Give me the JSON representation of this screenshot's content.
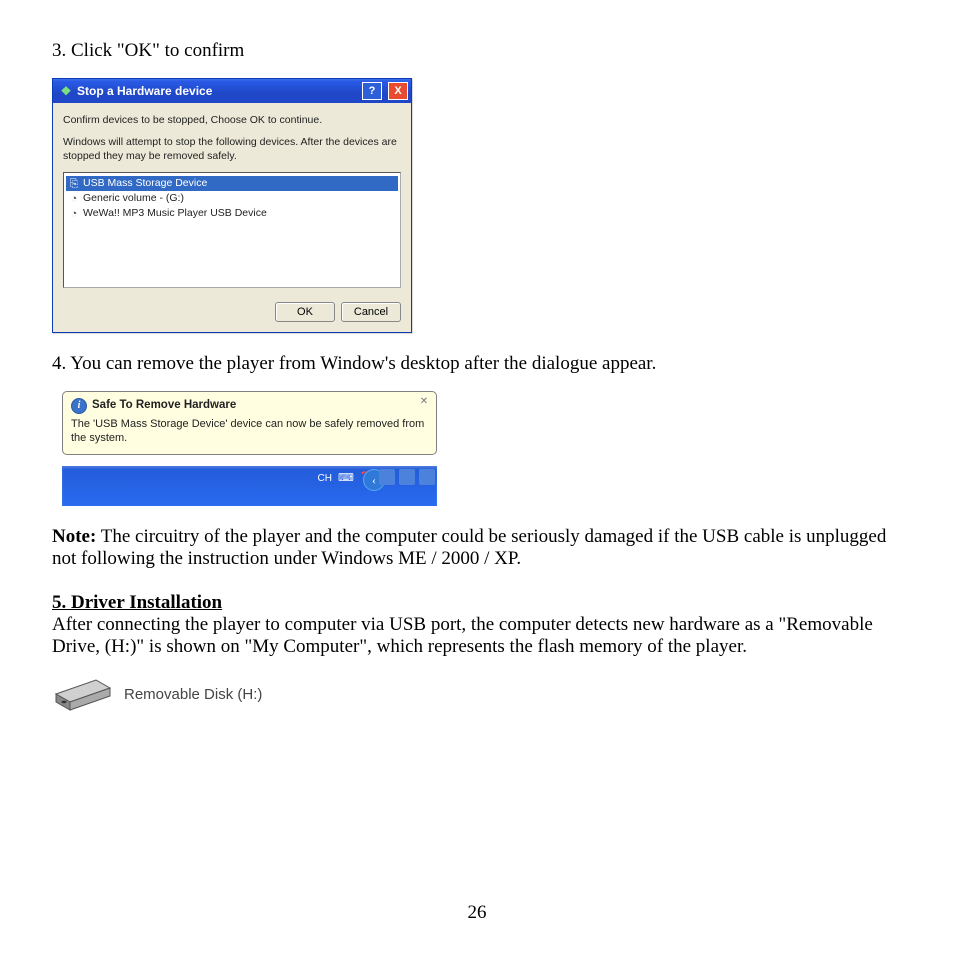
{
  "steps": {
    "step3": "3. Click \"OK\" to confirm",
    "step4": "4. You can remove the player from Window's desktop after the dialogue appear."
  },
  "dialog": {
    "title": "Stop a Hardware device",
    "instruction1": "Confirm devices to be stopped, Choose OK to continue.",
    "instruction2": "Windows will attempt to stop the following devices. After the devices are stopped they may be removed safely.",
    "list": {
      "item1": "USB Mass Storage Device",
      "item2": "Generic volume - (G:)",
      "item3": "WeWa!! MP3 Music Player USB Device"
    },
    "ok": "OK",
    "cancel": "Cancel"
  },
  "balloon": {
    "title": "Safe To Remove Hardware",
    "body": "The 'USB Mass Storage Device' device can now be safely removed from the system.",
    "ch": "CH"
  },
  "note": {
    "label": "Note:",
    "text": "  The circuitry of the player and the computer could be seriously damaged if the USB cable is unplugged not following the instruction under Windows ME / 2000 / XP."
  },
  "section5": {
    "heading": "5.  Driver Installation",
    "text": "After connecting the player to computer via USB port, the computer detects new hardware as a \"Removable Drive, (H:)\" is shown on \"My Computer\", which represents the flash memory of the player."
  },
  "drive": {
    "label": "Removable Disk (H:)"
  },
  "page_number": "26"
}
